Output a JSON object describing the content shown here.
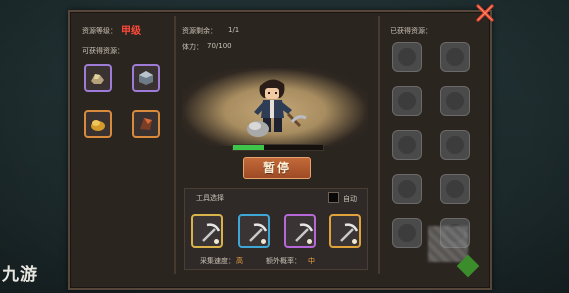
{
  "panel": {
    "resource_level_label": "资源等级：",
    "resource_level_value": "甲级",
    "obtainable_label": "可获得资源：",
    "remaining_label": "资源剩余：",
    "remaining_value": "1/1",
    "stamina_label": "体力：",
    "stamina_value": "70/100",
    "obtained_label": "已获得资源：",
    "pause_button": "暂停",
    "progress_fraction": 0.34
  },
  "tools": {
    "title": "工具选择",
    "auto_label": "自动",
    "collect_speed_label": "采集速度：",
    "collect_speed_value": "高",
    "drop_rate_label": "额外概率：",
    "drop_rate_value": "中",
    "slot_borders": [
      "#d9b24a",
      "#3fa7d6",
      "#b668d8",
      "#e0a23a"
    ]
  },
  "watermark": {
    "left_logo": "九游",
    "right_text": ""
  },
  "colors": {
    "accent_red": "#ff4a3a",
    "progress_green": "#3ec64a",
    "button_orange": "#c46a3a"
  }
}
